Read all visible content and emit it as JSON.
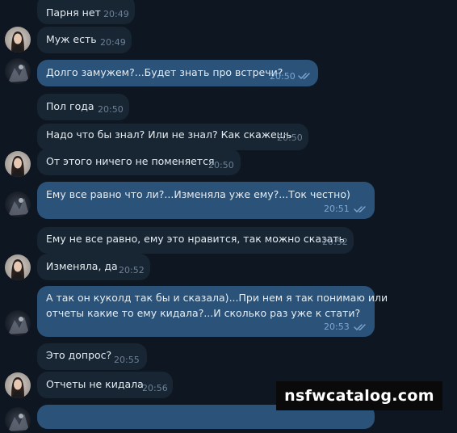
{
  "messages": [
    {
      "text": "Парня нет",
      "time": "20:49"
    },
    {
      "text": "Муж есть",
      "time": "20:49"
    },
    {
      "text": "Долго замужем?...Будет знать про встречи?",
      "time": "20:50"
    },
    {
      "text": "Пол года",
      "time": "20:50"
    },
    {
      "text": "Надо что бы знал? Или не знал? Как скажешь",
      "time": "20:50"
    },
    {
      "text": "От этого ничего не поменяется",
      "time": "20:50"
    },
    {
      "text": "Ему все равно что ли?...Изменяла уже ему?...Ток честно)",
      "time": "20:51"
    },
    {
      "text": "Ему не все равно, ему это нравится, так можно сказать",
      "time": "20:52"
    },
    {
      "text": "Изменяла, да",
      "time": "20:52"
    },
    {
      "line1": "А так он куколд так бы и сказала)...При нем я так понимаю или",
      "line2": "отчеты какие то ему кидала?...И сколько раз уже к стати?",
      "time": "20:53"
    },
    {
      "text": "Это допрос?",
      "time": "20:55"
    },
    {
      "text": "Отчеты не кидала",
      "time": "20:56"
    }
  ],
  "watermark": "nsfwcatalog.com",
  "colors": {
    "background": "#0e1621",
    "incoming_bubble": "#182533",
    "outgoing_bubble": "#2b5278",
    "read_check": "#7da8d3"
  },
  "icons": {
    "read_receipt": "double-check-icon"
  }
}
